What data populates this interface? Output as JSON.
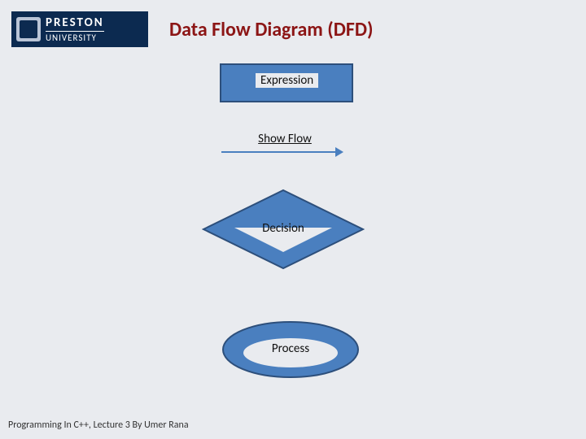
{
  "logo": {
    "line1": "PRESTON",
    "line2": "UNIVERSITY"
  },
  "title": "Data Flow Diagram (DFD)",
  "shapes": {
    "expression": "Expression",
    "flow": "Show Flow",
    "decision": "Decision",
    "process": "Process"
  },
  "colors": {
    "shape_fill": "#4a7fbf",
    "shape_stroke": "#2d4f7b",
    "title": "#8c1515",
    "background": "#e9ebef"
  },
  "footer": "Programming In C++, Lecture 3 By Umer Rana"
}
